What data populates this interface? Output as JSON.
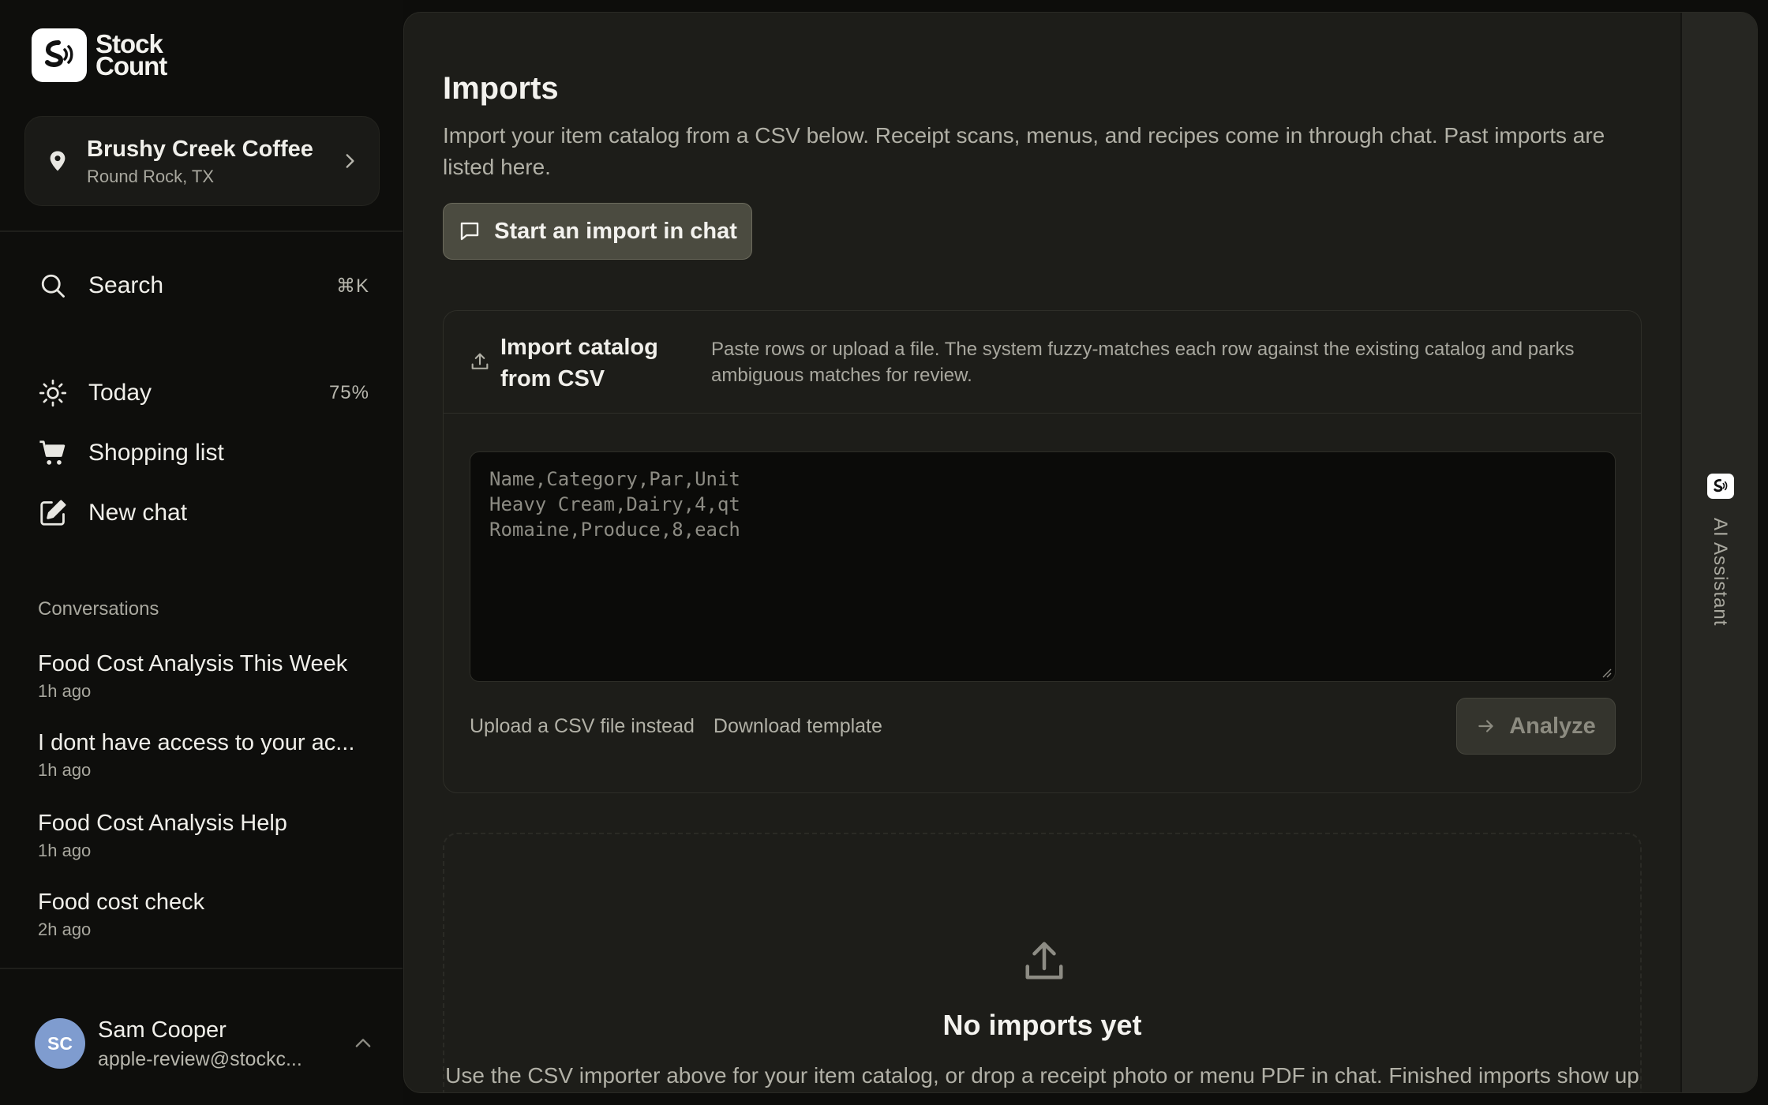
{
  "brand": {
    "line1": "Stock",
    "line2": "Count",
    "logo_icon": "stockcount-logo-icon"
  },
  "location": {
    "name": "Brushy Creek Coffee",
    "city": "Round Rock, TX"
  },
  "search": {
    "label": "Search",
    "shortcut": "⌘K"
  },
  "nav": {
    "today_label": "Today",
    "today_percent": "75%",
    "shopping_label": "Shopping list",
    "newchat_label": "New chat"
  },
  "conversations": {
    "heading": "Conversations",
    "items": [
      {
        "title": "Food Cost Analysis This Week",
        "time": "1h ago"
      },
      {
        "title": "I dont have access to your ac...",
        "time": "1h ago"
      },
      {
        "title": "Food Cost Analysis Help",
        "time": "1h ago"
      },
      {
        "title": "Food cost check",
        "time": "2h ago"
      }
    ]
  },
  "user": {
    "initials": "SC",
    "name": "Sam Cooper",
    "email": "apple-review@stockc..."
  },
  "page": {
    "title": "Imports",
    "description": "Import your item catalog from a CSV below. Receipt scans, menus, and recipes come in through chat. Past imports are listed here.",
    "start_import_label": "Start an import in chat"
  },
  "csv_import": {
    "title": "Import catalog from CSV",
    "subtitle": "Paste rows or upload a file. The system fuzzy-matches each row against the existing catalog and parks ambiguous matches for review.",
    "placeholder": "Name,Category,Par,Unit\nHeavy Cream,Dairy,4,qt\nRomaine,Produce,8,each",
    "upload_link": "Upload a CSV file instead",
    "template_link": "Download template",
    "analyze_label": "Analyze"
  },
  "empty_state": {
    "title": "No imports yet",
    "description": "Use the CSV importer above for your item catalog, or drop a receipt photo or menu PDF in chat. Finished imports show up here."
  },
  "assistant_rail": {
    "label": "AI Assistant"
  },
  "colors": {
    "background": "#0d0d0b",
    "panel": "#1d1d19",
    "primary_button": "#4b4b40",
    "avatar": "#7f9ccf"
  }
}
